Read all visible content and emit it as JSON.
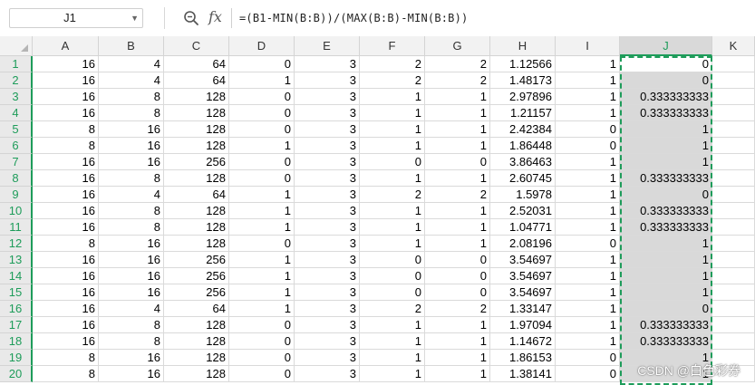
{
  "name_box": {
    "value": "J1"
  },
  "formula": {
    "text": "=(B1-MIN(B:B))/(MAX(B:B)-MIN(B:B))"
  },
  "icons": {
    "zoom": "zoom-icon",
    "fx": "fx"
  },
  "columns": [
    "A",
    "B",
    "C",
    "D",
    "E",
    "F",
    "G",
    "H",
    "I",
    "J",
    "K"
  ],
  "selected_column": "J",
  "rows": [
    {
      "n": "1",
      "cells": [
        "16",
        "4",
        "64",
        "0",
        "3",
        "2",
        "2",
        "1.12566",
        "1",
        "0"
      ]
    },
    {
      "n": "2",
      "cells": [
        "16",
        "4",
        "64",
        "1",
        "3",
        "2",
        "2",
        "1.48173",
        "1",
        "0"
      ]
    },
    {
      "n": "3",
      "cells": [
        "16",
        "8",
        "128",
        "0",
        "3",
        "1",
        "1",
        "2.97896",
        "1",
        "0.333333333"
      ]
    },
    {
      "n": "4",
      "cells": [
        "16",
        "8",
        "128",
        "0",
        "3",
        "1",
        "1",
        "1.21157",
        "1",
        "0.333333333"
      ]
    },
    {
      "n": "5",
      "cells": [
        "8",
        "16",
        "128",
        "0",
        "3",
        "1",
        "1",
        "2.42384",
        "0",
        "1"
      ]
    },
    {
      "n": "6",
      "cells": [
        "8",
        "16",
        "128",
        "1",
        "3",
        "1",
        "1",
        "1.86448",
        "0",
        "1"
      ]
    },
    {
      "n": "7",
      "cells": [
        "16",
        "16",
        "256",
        "0",
        "3",
        "0",
        "0",
        "3.86463",
        "1",
        "1"
      ]
    },
    {
      "n": "8",
      "cells": [
        "16",
        "8",
        "128",
        "0",
        "3",
        "1",
        "1",
        "2.60745",
        "1",
        "0.333333333"
      ]
    },
    {
      "n": "9",
      "cells": [
        "16",
        "4",
        "64",
        "1",
        "3",
        "2",
        "2",
        "1.5978",
        "1",
        "0"
      ]
    },
    {
      "n": "10",
      "cells": [
        "16",
        "8",
        "128",
        "1",
        "3",
        "1",
        "1",
        "2.52031",
        "1",
        "0.333333333"
      ]
    },
    {
      "n": "11",
      "cells": [
        "16",
        "8",
        "128",
        "1",
        "3",
        "1",
        "1",
        "1.04771",
        "1",
        "0.333333333"
      ]
    },
    {
      "n": "12",
      "cells": [
        "8",
        "16",
        "128",
        "0",
        "3",
        "1",
        "1",
        "2.08196",
        "0",
        "1"
      ]
    },
    {
      "n": "13",
      "cells": [
        "16",
        "16",
        "256",
        "1",
        "3",
        "0",
        "0",
        "3.54697",
        "1",
        "1"
      ]
    },
    {
      "n": "14",
      "cells": [
        "16",
        "16",
        "256",
        "1",
        "3",
        "0",
        "0",
        "3.54697",
        "1",
        "1"
      ]
    },
    {
      "n": "15",
      "cells": [
        "16",
        "16",
        "256",
        "1",
        "3",
        "0",
        "0",
        "3.54697",
        "1",
        "1"
      ]
    },
    {
      "n": "16",
      "cells": [
        "16",
        "4",
        "64",
        "1",
        "3",
        "2",
        "2",
        "1.33147",
        "1",
        "0"
      ]
    },
    {
      "n": "17",
      "cells": [
        "16",
        "8",
        "128",
        "0",
        "3",
        "1",
        "1",
        "1.97094",
        "1",
        "0.333333333"
      ]
    },
    {
      "n": "18",
      "cells": [
        "16",
        "8",
        "128",
        "0",
        "3",
        "1",
        "1",
        "1.14672",
        "1",
        "0.333333333"
      ]
    },
    {
      "n": "19",
      "cells": [
        "8",
        "16",
        "128",
        "0",
        "3",
        "1",
        "1",
        "1.86153",
        "0",
        "1"
      ]
    },
    {
      "n": "20",
      "cells": [
        "8",
        "16",
        "128",
        "0",
        "3",
        "1",
        "1",
        "1.38141",
        "0",
        "1"
      ]
    }
  ],
  "watermark": "CSDN @白色彩券",
  "colors": {
    "accent": "#1e9c5a",
    "selected_fill": "#d9d9d9",
    "header_bg": "#f2f2f2"
  }
}
